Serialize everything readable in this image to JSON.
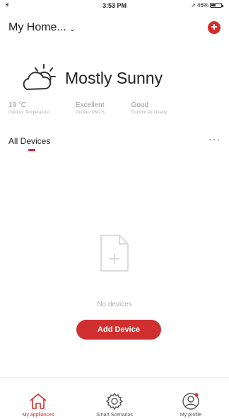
{
  "status_bar": {
    "signal": "•ıl",
    "time": "3:53 PM",
    "battery": "46%"
  },
  "header": {
    "home_name": "My Home...",
    "chevron_icon": "chevron-down-icon",
    "add_icon": "plus-circle-icon"
  },
  "weather": {
    "icon": "partly-sunny-icon",
    "condition": "Mostly Sunny"
  },
  "stats": [
    {
      "value": "19 °C",
      "label": "Outdoor Temperature"
    },
    {
      "value": "Excellent",
      "label": "Outdoor PM2.5"
    },
    {
      "value": "Good",
      "label": "Outdoor Air Quality"
    }
  ],
  "tabs": {
    "active_label": "All Devices",
    "more_icon": "more-icon"
  },
  "empty_state": {
    "icon": "document-plus-icon",
    "text": "No devices",
    "button_label": "Add Device"
  },
  "tab_bar": [
    {
      "label": "My appliances",
      "icon": "home-icon",
      "active": true
    },
    {
      "label": "Smart Scenarios",
      "icon": "gear-icon",
      "active": false
    },
    {
      "label": "My profile",
      "icon": "profile-icon",
      "active": false
    }
  ],
  "colors": {
    "accent": "#d62c2c",
    "muted": "#9a9a9a"
  }
}
